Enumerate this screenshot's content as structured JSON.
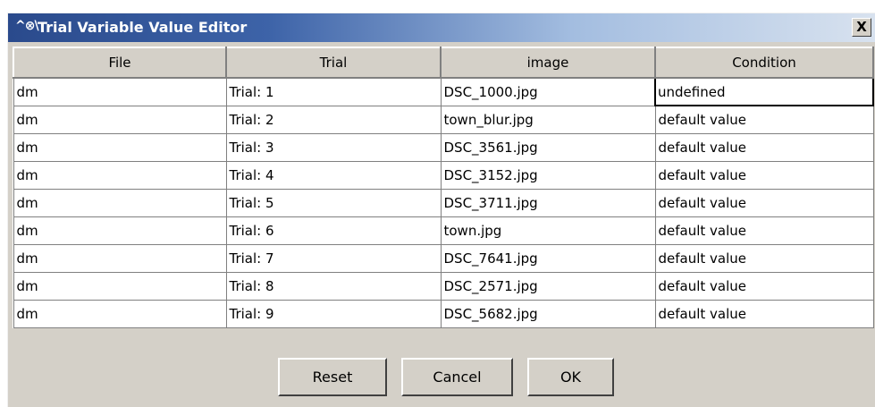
{
  "window": {
    "icon": "^⊗\\",
    "title": "Trial Variable Value Editor",
    "close_label": "X"
  },
  "table": {
    "headers": [
      "File",
      "Trial",
      "image",
      "Condition"
    ],
    "rows": [
      [
        "dm",
        "Trial: 1",
        "DSC_1000.jpg",
        "undefined"
      ],
      [
        "dm",
        "Trial: 2",
        "town_blur.jpg",
        "default value"
      ],
      [
        "dm",
        "Trial: 3",
        "DSC_3561.jpg",
        "default value"
      ],
      [
        "dm",
        "Trial: 4",
        "DSC_3152.jpg",
        "default value"
      ],
      [
        "dm",
        "Trial: 5",
        "DSC_3711.jpg",
        "default value"
      ],
      [
        "dm",
        "Trial: 6",
        "town.jpg",
        "default value"
      ],
      [
        "dm",
        "Trial: 7",
        "DSC_7641.jpg",
        "default value"
      ],
      [
        "dm",
        "Trial: 8",
        "DSC_2571.jpg",
        "default value"
      ],
      [
        "dm",
        "Trial: 9",
        "DSC_5682.jpg",
        "default value"
      ]
    ]
  },
  "buttons": {
    "reset": "Reset",
    "cancel": "Cancel",
    "ok": "OK"
  }
}
